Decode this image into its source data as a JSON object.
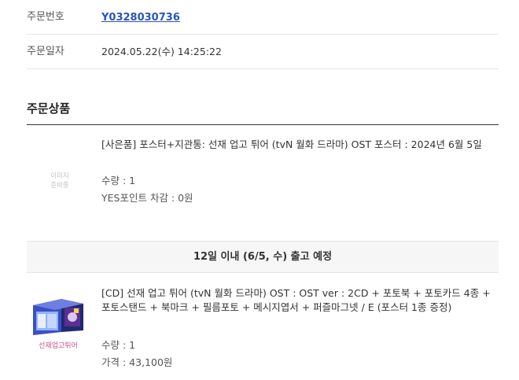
{
  "order": {
    "number_label": "주문번호",
    "number_value": "Y0328030736",
    "date_label": "주문일자",
    "date_value": "2024.05.22(수) 14:25:22"
  },
  "section": {
    "title": "주문상품"
  },
  "items": [
    {
      "image_placeholder": "이미지\n준비중",
      "title": "[사은품] 포스터+지관통: 선재 업고 튀어 (tvN 월화 드라마) OST 포스터 : 2024년 6월 5일",
      "quantity": "수량 : 1",
      "extra": "YES포인트 차감 : 0원"
    },
    {
      "title": "[CD] 선재 업고 튀어 (tvN 월화 드라마) OST : OST ver : 2CD + 포토북 + 포토카드 4종 + 포토스탠드 + 북마크 + 필름포토 + 메시지엽서 + 퍼즐마그넷 / E (포스터 1종 증정)",
      "quantity": "수량 : 1",
      "price": "가격 : 43,100원",
      "cover_caption": "선재업고튀어"
    }
  ],
  "shipping": {
    "notice": "12일 이내 (6/5, 수) 출고 예정"
  },
  "colors": {
    "link": "#2a55b8",
    "divider": "#e6e6e6",
    "ship_bar_bg": "#f6f6f6"
  }
}
